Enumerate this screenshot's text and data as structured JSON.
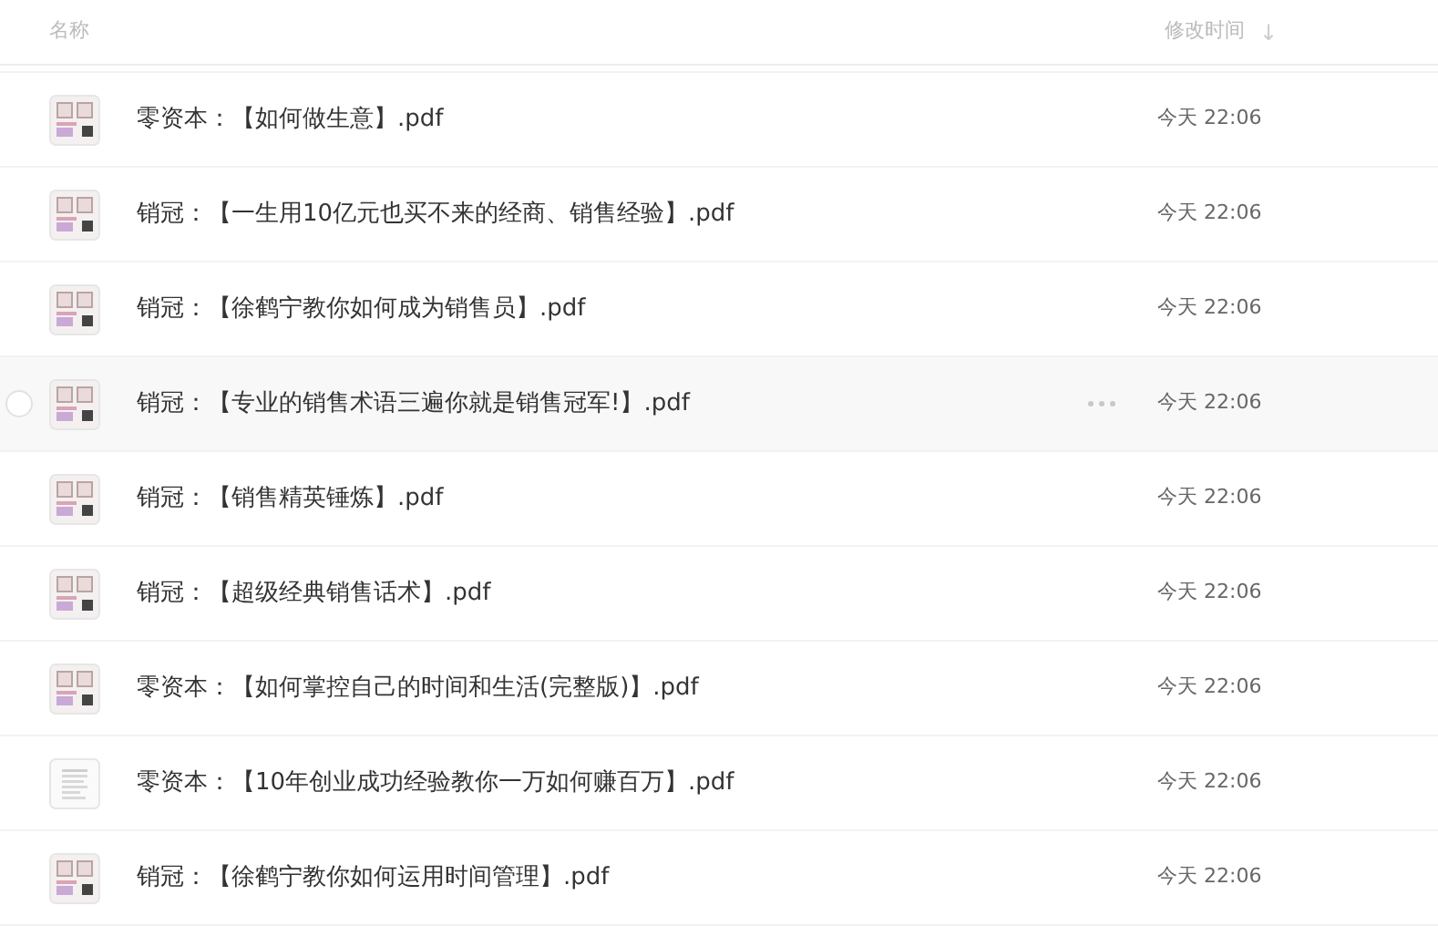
{
  "header": {
    "name_column": "名称",
    "time_column": "修改时间",
    "sort_icon": "↓"
  },
  "files": [
    {
      "name": "零资本：【如何做生意】.pdf",
      "modified": "今天 22:06",
      "kind": "cover",
      "hovered": false
    },
    {
      "name": "销冠：【一生用10亿元也买不来的经商、销售经验】.pdf",
      "modified": "今天 22:06",
      "kind": "cover",
      "hovered": false
    },
    {
      "name": "销冠：【徐鹤宁教你如何成为销售员】.pdf",
      "modified": "今天 22:06",
      "kind": "cover",
      "hovered": false
    },
    {
      "name": "销冠：【专业的销售术语三遍你就是销售冠军!】.pdf",
      "modified": "今天 22:06",
      "kind": "cover",
      "hovered": true
    },
    {
      "name": "销冠：【销售精英锤炼】.pdf",
      "modified": "今天 22:06",
      "kind": "cover",
      "hovered": false
    },
    {
      "name": "销冠：【超级经典销售话术】.pdf",
      "modified": "今天 22:06",
      "kind": "cover",
      "hovered": false
    },
    {
      "name": "零资本：【如何掌控自己的时间和生活(完整版)】.pdf",
      "modified": "今天 22:06",
      "kind": "cover",
      "hovered": false
    },
    {
      "name": "零资本：【10年创业成功经验教你一万如何赚百万】.pdf",
      "modified": "今天 22:06",
      "kind": "document",
      "hovered": false
    },
    {
      "name": "销冠：【徐鹤宁教你如何运用时间管理】.pdf",
      "modified": "今天 22:06",
      "kind": "cover",
      "hovered": false
    }
  ]
}
